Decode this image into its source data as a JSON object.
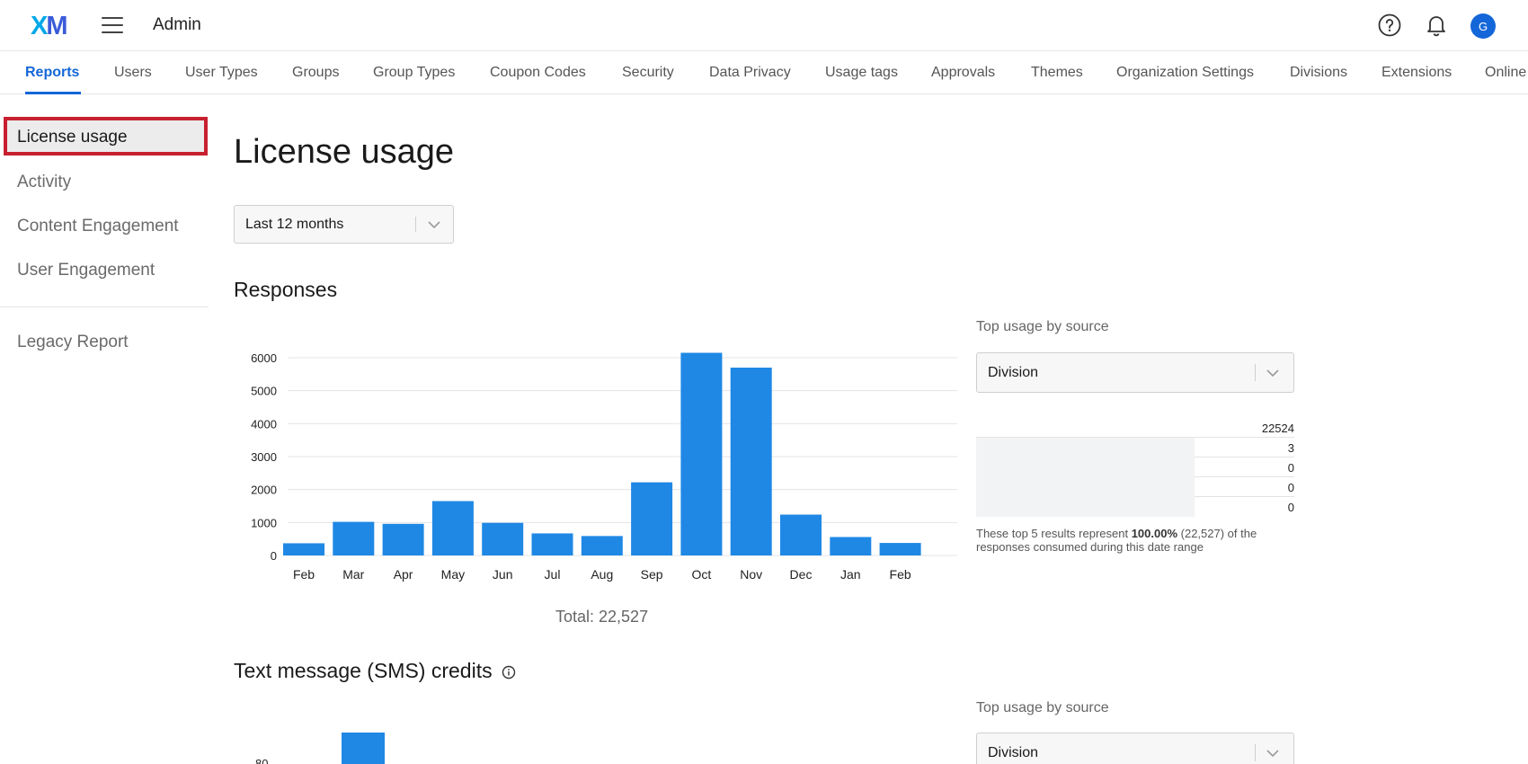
{
  "header": {
    "logo": "XM",
    "title": "Admin",
    "avatar_initial": "G",
    "icons": [
      "hamburger-icon",
      "help-icon",
      "bell-icon"
    ]
  },
  "tabs": [
    {
      "label": "Reports",
      "active": true
    },
    {
      "label": "Users"
    },
    {
      "label": "User Types"
    },
    {
      "label": "Groups"
    },
    {
      "label": "Group Types"
    },
    {
      "label": "Coupon Codes"
    },
    {
      "label": "Security"
    },
    {
      "label": "Data Privacy"
    },
    {
      "label": "Usage tags"
    },
    {
      "label": "Approvals"
    },
    {
      "label": "Themes"
    },
    {
      "label": "Organization Settings"
    },
    {
      "label": "Divisions"
    },
    {
      "label": "Extensions"
    },
    {
      "label": "Online"
    }
  ],
  "sidebar": {
    "items": [
      "License usage",
      "Activity",
      "Content Engagement",
      "User Engagement",
      "Legacy Report"
    ],
    "active_index": 0
  },
  "main": {
    "title": "License usage",
    "date_range": "Last 12 months",
    "responses": {
      "title": "Responses",
      "total": "Total: 22,527",
      "top_usage_label": "Top usage by source",
      "source_select": "Division",
      "usage_total": "22524",
      "usage_values": [
        "3",
        "0",
        "0",
        "0"
      ],
      "note_prefix": "These top 5 results represent ",
      "note_percent": "100.00%",
      "note_suffix": " (22,527) of the responses consumed during this date range"
    },
    "sms": {
      "title": "Text message (SMS) credits",
      "top_usage_label": "Top usage by source",
      "source_select": "Division",
      "y_tick_visible": "80"
    }
  },
  "colors": {
    "accent": "#1467d8",
    "bar": "#1f88e5",
    "highlight_border": "#c8202f"
  },
  "chart_data": {
    "type": "bar",
    "title": "",
    "categories": [
      "Feb",
      "Mar",
      "Apr",
      "May",
      "Jun",
      "Jul",
      "Aug",
      "Sep",
      "Oct",
      "Nov",
      "Dec",
      "Jan",
      "Feb"
    ],
    "values": [
      370,
      1020,
      960,
      1650,
      990,
      670,
      590,
      2220,
      6150,
      5700,
      1240,
      560,
      380
    ],
    "xlabel": "",
    "ylabel": "",
    "ylim": [
      0,
      6000
    ],
    "yticks": [
      0,
      1000,
      2000,
      3000,
      4000,
      5000,
      6000
    ],
    "grid": true,
    "legend": "none"
  }
}
